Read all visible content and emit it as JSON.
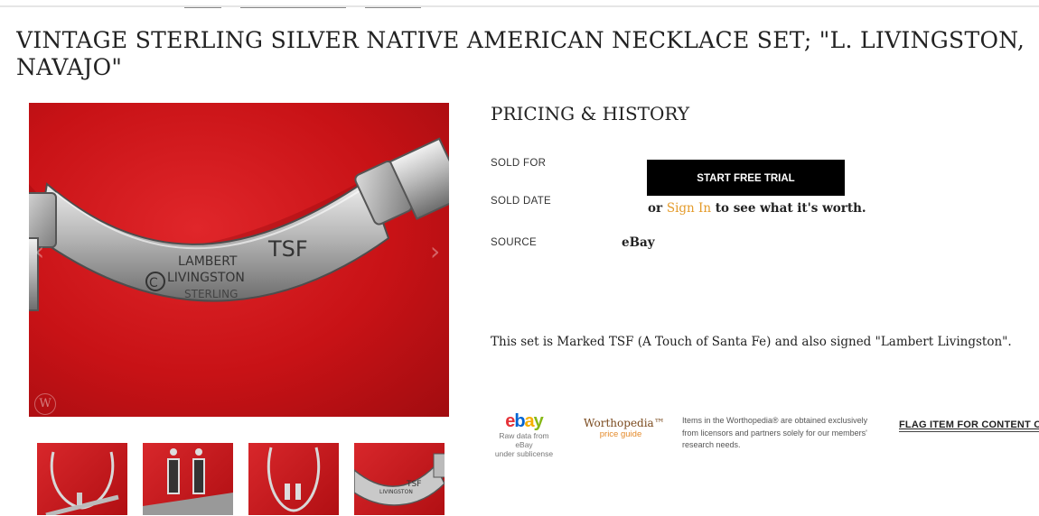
{
  "item": {
    "title_line1": "VINTAGE STERLING SILVER NATIVE AMERICAN NECKLACE SET; \"L. LIVINGSTON,",
    "title_line2": "NAVAJO\""
  },
  "gallery": {
    "main_image_alt": "LAMBERT TSF LIVINGSTON STERLING",
    "main_engraving": [
      "LAMBERT",
      "TSF",
      "LIVINGSTON",
      "STERLING"
    ],
    "thumbnail_count": 4,
    "watermark_letter": "W"
  },
  "pricing": {
    "heading": "PRICING & HISTORY",
    "sold_for_label": "SOLD FOR",
    "sold_date_label": "SOLD DATE",
    "source_label": "SOURCE",
    "source_value": "eBay",
    "cta_button": "START FREE TRIAL",
    "signin_prefix": "or",
    "signin_link": "Sign In",
    "signin_suffix": "to see what it's worth."
  },
  "description": "This set is Marked TSF (A Touch of Santa Fe) and also signed \"Lambert Livingston\".",
  "footer": {
    "ebay_logo_letters": [
      "e",
      "b",
      "a",
      "y"
    ],
    "ebay_caption_line1": "Raw data from eBay",
    "ebay_caption_line2": "under sublicense",
    "worthopedia_name": "Worthopedia™",
    "worthopedia_sub": "price guide",
    "disclaimer": "Items in the Worthopedia® are obtained exclusively from licensors and partners solely for our members' research needs.",
    "flag_link": "FLAG ITEM FOR CONTENT OR"
  },
  "colors": {
    "accent_link": "#e49b2a",
    "button_bg": "#000000",
    "image_red": "#c81216",
    "ebay_e": "#e53238",
    "ebay_b": "#0064d2",
    "ebay_a": "#f5af02",
    "ebay_y": "#86b817"
  }
}
